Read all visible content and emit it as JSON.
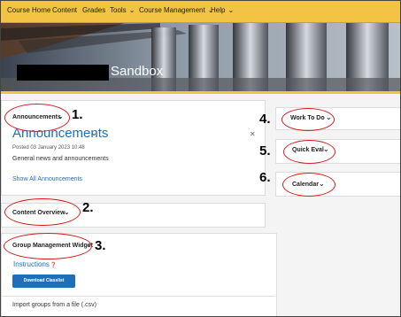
{
  "nav": {
    "items": [
      "Course Home",
      "Content",
      "Grades",
      "Tools",
      "Course Management",
      "Help"
    ]
  },
  "banner": {
    "title": "Sandbox"
  },
  "widgets": {
    "announcements": {
      "title": "Announcements",
      "heading": "Announcements",
      "posted": "Posted 03 January 2023 10:48",
      "body": "General news and announcements",
      "show_all": "Show All Announcements"
    },
    "content_overview": {
      "title": "Content Overview"
    },
    "group_management": {
      "title": "Group Management Widget",
      "instructions": "Instructions",
      "download_button": "Download Classlist",
      "import_text": "Import groups from a file (.csv)"
    },
    "work_to_do": {
      "title": "Work To Do"
    },
    "quick_eval": {
      "title": "Quick Eval"
    },
    "calendar": {
      "title": "Calendar"
    }
  },
  "annotations": [
    "1.",
    "2.",
    "3.",
    "4.",
    "5.",
    "6."
  ],
  "colors": {
    "nav_bg": "#f3c443",
    "link": "#1f6fb8",
    "annotation": "#d81b1b"
  }
}
